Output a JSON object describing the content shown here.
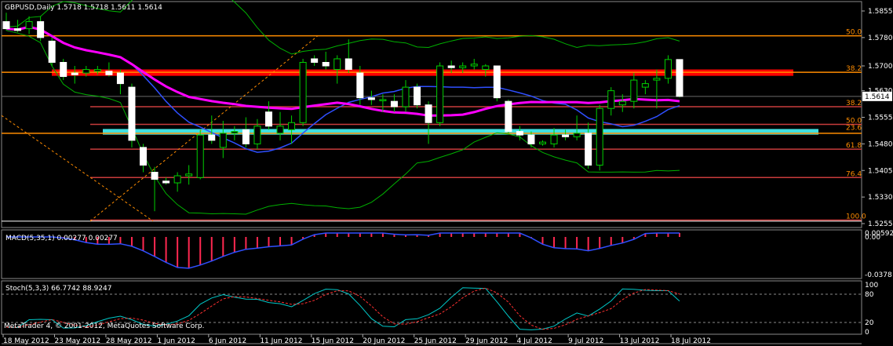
{
  "title": "GBPUSD,Daily",
  "ohlc_readout": "1.5718 1.5718 1.5611 1.5614",
  "copyright": "MetaTrader 4, © 2001-2012, MetaQuotes Software Corp.",
  "colors": {
    "background": "#000000",
    "grid": "#5a5a5a",
    "bull": "#ffffff",
    "bear": "#ffffff",
    "wick": "#00d000",
    "ma_fast": "#ff00ff",
    "ma_slow": "#2f4fff",
    "bands": "#00b000",
    "fib_lines": "#c83c3c",
    "fib_labels": "#ff8c00",
    "macd_hist": "#ff2850",
    "macd_signal": "#2f4fff",
    "stoch_main": "#00c8c8",
    "stoch_signal": "#ff3030",
    "rect_red": "#ff0000",
    "rect_cyan": "#40e0e0",
    "hline_orange": "#ff8c00"
  },
  "chart_data": [
    {
      "type": "candlestick",
      "title": "GBPUSD,Daily",
      "y_ticks": [
        "1.5855",
        "1.5780",
        "1.5700",
        "1.5630",
        "1.5555",
        "1.5480",
        "1.5405",
        "1.5330",
        "1.5255"
      ],
      "ylim": [
        1.5255,
        1.5855
      ],
      "current_price_label": "1.5614",
      "x_labels": [
        "18 May 2012",
        "23 May 2012",
        "28 May 2012",
        "1 Jun 2012",
        "6 Jun 2012",
        "11 Jun 2012",
        "15 Jun 2012",
        "20 Jun 2012",
        "25 Jun 2012",
        "29 Jun 2012",
        "4 Jul 2012",
        "9 Jul 2012",
        "13 Jul 2012",
        "18 Jul 2012"
      ],
      "candles": [
        {
          "o": 1.5825,
          "h": 1.585,
          "l": 1.58,
          "c": 1.5805
        },
        {
          "o": 1.5805,
          "h": 1.583,
          "l": 1.5795,
          "c": 1.58
        },
        {
          "o": 1.5805,
          "h": 1.584,
          "l": 1.579,
          "c": 1.5825
        },
        {
          "o": 1.5825,
          "h": 1.584,
          "l": 1.577,
          "c": 1.578
        },
        {
          "o": 1.577,
          "h": 1.578,
          "l": 1.57,
          "c": 1.571
        },
        {
          "o": 1.571,
          "h": 1.572,
          "l": 1.566,
          "c": 1.567
        },
        {
          "o": 1.568,
          "h": 1.57,
          "l": 1.565,
          "c": 1.5675
        },
        {
          "o": 1.568,
          "h": 1.57,
          "l": 1.567,
          "c": 1.569
        },
        {
          "o": 1.5685,
          "h": 1.57,
          "l": 1.5675,
          "c": 1.569
        },
        {
          "o": 1.5685,
          "h": 1.571,
          "l": 1.567,
          "c": 1.5675
        },
        {
          "o": 1.568,
          "h": 1.569,
          "l": 1.562,
          "c": 1.565
        },
        {
          "o": 1.564,
          "h": 1.565,
          "l": 1.547,
          "c": 1.549
        },
        {
          "o": 1.547,
          "h": 1.548,
          "l": 1.54,
          "c": 1.542
        },
        {
          "o": 1.54,
          "h": 1.5415,
          "l": 1.529,
          "c": 1.538
        },
        {
          "o": 1.5375,
          "h": 1.5385,
          "l": 1.5365,
          "c": 1.537
        },
        {
          "o": 1.537,
          "h": 1.54,
          "l": 1.5345,
          "c": 1.539
        },
        {
          "o": 1.539,
          "h": 1.542,
          "l": 1.5365,
          "c": 1.5395
        },
        {
          "o": 1.5385,
          "h": 1.552,
          "l": 1.538,
          "c": 1.5505
        },
        {
          "o": 1.5505,
          "h": 1.556,
          "l": 1.548,
          "c": 1.549
        },
        {
          "o": 1.547,
          "h": 1.5545,
          "l": 1.544,
          "c": 1.551
        },
        {
          "o": 1.551,
          "h": 1.553,
          "l": 1.549,
          "c": 1.5515
        },
        {
          "o": 1.552,
          "h": 1.5555,
          "l": 1.547,
          "c": 1.548
        },
        {
          "o": 1.548,
          "h": 1.555,
          "l": 1.5465,
          "c": 1.553
        },
        {
          "o": 1.557,
          "h": 1.56,
          "l": 1.552,
          "c": 1.553
        },
        {
          "o": 1.551,
          "h": 1.557,
          "l": 1.549,
          "c": 1.553
        },
        {
          "o": 1.552,
          "h": 1.556,
          "l": 1.548,
          "c": 1.554
        },
        {
          "o": 1.554,
          "h": 1.572,
          "l": 1.553,
          "c": 1.571
        },
        {
          "o": 1.572,
          "h": 1.573,
          "l": 1.57,
          "c": 1.571
        },
        {
          "o": 1.571,
          "h": 1.574,
          "l": 1.569,
          "c": 1.57
        },
        {
          "o": 1.569,
          "h": 1.573,
          "l": 1.565,
          "c": 1.572
        },
        {
          "o": 1.572,
          "h": 1.5775,
          "l": 1.568,
          "c": 1.569
        },
        {
          "o": 1.568,
          "h": 1.57,
          "l": 1.559,
          "c": 1.561
        },
        {
          "o": 1.561,
          "h": 1.563,
          "l": 1.559,
          "c": 1.5605
        },
        {
          "o": 1.5605,
          "h": 1.562,
          "l": 1.557,
          "c": 1.5605
        },
        {
          "o": 1.56,
          "h": 1.562,
          "l": 1.557,
          "c": 1.5585
        },
        {
          "o": 1.5585,
          "h": 1.566,
          "l": 1.557,
          "c": 1.564
        },
        {
          "o": 1.564,
          "h": 1.565,
          "l": 1.558,
          "c": 1.559
        },
        {
          "o": 1.559,
          "h": 1.56,
          "l": 1.548,
          "c": 1.554
        },
        {
          "o": 1.554,
          "h": 1.571,
          "l": 1.553,
          "c": 1.57
        },
        {
          "o": 1.57,
          "h": 1.5715,
          "l": 1.568,
          "c": 1.5695
        },
        {
          "o": 1.5695,
          "h": 1.571,
          "l": 1.568,
          "c": 1.57
        },
        {
          "o": 1.57,
          "h": 1.572,
          "l": 1.569,
          "c": 1.5705
        },
        {
          "o": 1.569,
          "h": 1.5705,
          "l": 1.567,
          "c": 1.57
        },
        {
          "o": 1.57,
          "h": 1.57,
          "l": 1.56,
          "c": 1.561
        },
        {
          "o": 1.56,
          "h": 1.5605,
          "l": 1.551,
          "c": 1.5515
        },
        {
          "o": 1.5515,
          "h": 1.553,
          "l": 1.549,
          "c": 1.5505
        },
        {
          "o": 1.5505,
          "h": 1.5515,
          "l": 1.547,
          "c": 1.548
        },
        {
          "o": 1.548,
          "h": 1.549,
          "l": 1.5475,
          "c": 1.5485
        },
        {
          "o": 1.548,
          "h": 1.5525,
          "l": 1.547,
          "c": 1.5505
        },
        {
          "o": 1.5505,
          "h": 1.552,
          "l": 1.549,
          "c": 1.55
        },
        {
          "o": 1.55,
          "h": 1.556,
          "l": 1.549,
          "c": 1.551
        },
        {
          "o": 1.551,
          "h": 1.554,
          "l": 1.541,
          "c": 1.542
        },
        {
          "o": 1.542,
          "h": 1.559,
          "l": 1.5405,
          "c": 1.558
        },
        {
          "o": 1.558,
          "h": 1.564,
          "l": 1.556,
          "c": 1.563
        },
        {
          "o": 1.559,
          "h": 1.562,
          "l": 1.557,
          "c": 1.56
        },
        {
          "o": 1.56,
          "h": 1.568,
          "l": 1.558,
          "c": 1.566
        },
        {
          "o": 1.564,
          "h": 1.566,
          "l": 1.562,
          "c": 1.565
        },
        {
          "o": 1.566,
          "h": 1.569,
          "l": 1.558,
          "c": 1.5665
        },
        {
          "o": 1.5665,
          "h": 1.573,
          "l": 1.565,
          "c": 1.5718
        },
        {
          "o": 1.5718,
          "h": 1.5718,
          "l": 1.5611,
          "c": 1.5614
        }
      ],
      "fib_levels": [
        {
          "label": "50.0",
          "value": 1.5785
        },
        {
          "label": "38.2",
          "value": 1.5682
        },
        {
          "label": "38.2",
          "value": 1.5585
        },
        {
          "label": "50.0",
          "value": 1.5535
        },
        {
          "label": "23.6",
          "value": 1.5515
        },
        {
          "label": "61.8",
          "value": 1.5465
        },
        {
          "label": "76.4",
          "value": 1.5385
        },
        {
          "label": "100.0",
          "value": 1.5265
        }
      ]
    },
    {
      "type": "bar",
      "title": "MACD(5,35,1) 0.00277 0.00277",
      "y_ticks": [
        "0.00592",
        "0.00",
        "-0.0378"
      ]
    },
    {
      "type": "line",
      "title": "Stoch(5,3,3) 66.7742 88.9247",
      "y_ticks": [
        "100",
        "80",
        "20",
        "0"
      ]
    }
  ]
}
